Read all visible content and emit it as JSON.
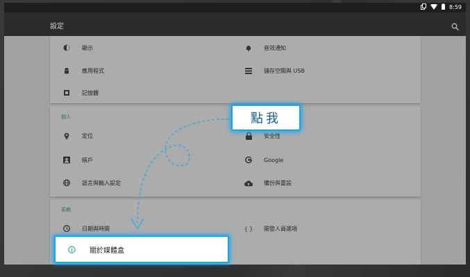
{
  "status": {
    "time": "8:59"
  },
  "appbar": {
    "title": "設定"
  },
  "device_section": {
    "items_left": [
      "顯示",
      "應用程式",
      "記憶體"
    ],
    "items_right": [
      "音效通知",
      "儲存空間與 USB"
    ]
  },
  "personal_section": {
    "title": "個人",
    "items_left": [
      "定位",
      "帳戶",
      "語言與輸入設定"
    ],
    "items_right": [
      "安全性",
      "Google",
      "備份與重設"
    ]
  },
  "system_section": {
    "title": "系統",
    "items_left": [
      "日期與時間"
    ],
    "items_right": [
      "開發人員選項"
    ],
    "highlighted_item": "關於媒體盒"
  },
  "callout": {
    "text": "點我"
  },
  "colors": {
    "accent": "#3c8c84",
    "highlight": "#1aa4e6"
  },
  "icons": [
    "display-icon",
    "bell-icon",
    "android-icon",
    "storage-icon",
    "memory-icon",
    "location-icon",
    "lock-icon",
    "account-icon",
    "google-icon",
    "globe-icon",
    "cloud-upload-icon",
    "clock-icon",
    "code-braces-icon",
    "info-icon",
    "search-icon",
    "wifi-icon",
    "battery-icon"
  ]
}
